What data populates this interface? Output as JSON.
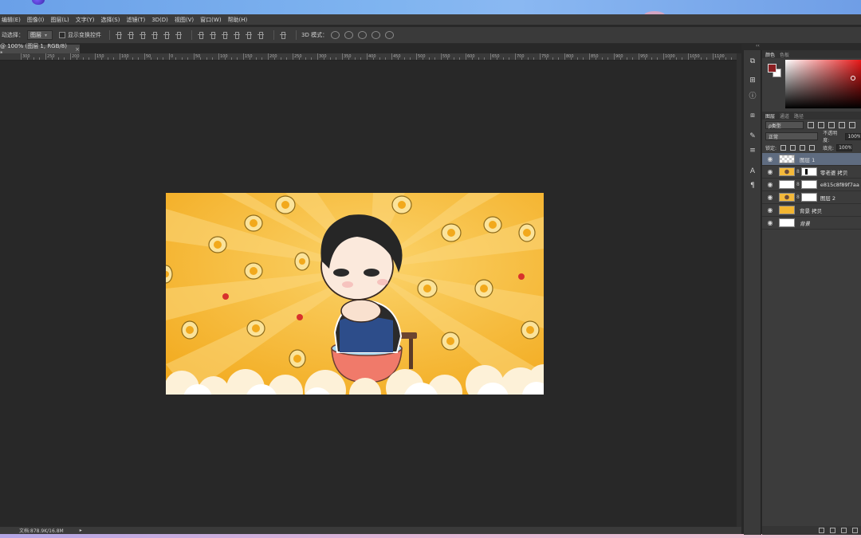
{
  "menubar": {
    "items": [
      "编辑(E)",
      "图像(I)",
      "图层(L)",
      "文字(Y)",
      "选择(S)",
      "滤镜(T)",
      "3D(D)",
      "视图(V)",
      "窗口(W)",
      "帮助(H)"
    ]
  },
  "options": {
    "auto_select_label": "动选择：",
    "auto_select_value": "图层",
    "show_transform_label": "显示变换控件",
    "mode3d_label": "3D 模式："
  },
  "document": {
    "tab_title": "@ 100% (图层 1, RGB/8) *",
    "close_glyph": "×"
  },
  "ruler": {
    "labels": [
      "300",
      "250",
      "200",
      "150",
      "100",
      "50",
      "0",
      "50",
      "100",
      "150",
      "200",
      "250",
      "300",
      "350",
      "400",
      "450",
      "500",
      "550",
      "600",
      "650",
      "700",
      "750",
      "800",
      "850",
      "900",
      "950",
      "1000",
      "1050",
      "1100"
    ]
  },
  "status": {
    "doc_size": "文档:878.9K/16.8M",
    "arrow": "▸"
  },
  "panels": {
    "collapse_glyph": "‹‹",
    "color_tabs": [
      "颜色",
      "色板"
    ],
    "layer_tabs": [
      "图层",
      "通道",
      "路径"
    ],
    "kind_filter": "ρ类型",
    "blend_mode": "正常",
    "opacity_label": "不透明度:",
    "opacity_value": "100%",
    "lock_label": "锁定:",
    "fill_label": "填充:",
    "fill_value": "100%"
  },
  "colors": {
    "foreground": "#8b1f22",
    "background": "#ffffff",
    "selected_layer": "#5f6c80",
    "art_base": "#f5b82e"
  },
  "layers": [
    {
      "name": "图层 1",
      "thumb": "checker",
      "selected": true,
      "mask": false
    },
    {
      "name": "零老婆 拷贝",
      "thumb": "art",
      "selected": false,
      "mask": "dark"
    },
    {
      "name": "e815c8f89f7aa",
      "thumb": "white",
      "selected": false,
      "mask": "white"
    },
    {
      "name": "图层 2",
      "thumb": "art",
      "selected": false,
      "mask": "white"
    },
    {
      "name": "背景 拷贝",
      "thumb": "yellow",
      "selected": false,
      "mask": false
    },
    {
      "name": "背景",
      "thumb": "white",
      "selected": false,
      "mask": false,
      "italic": true
    }
  ],
  "icons": {
    "eye": "eye-icon",
    "dock": [
      "history-icon",
      "properties-icon",
      "info-icon",
      "clone-source-icon",
      "brush-preset-icon",
      "adjust-icon",
      "character-icon",
      "paragraph-icon"
    ]
  }
}
